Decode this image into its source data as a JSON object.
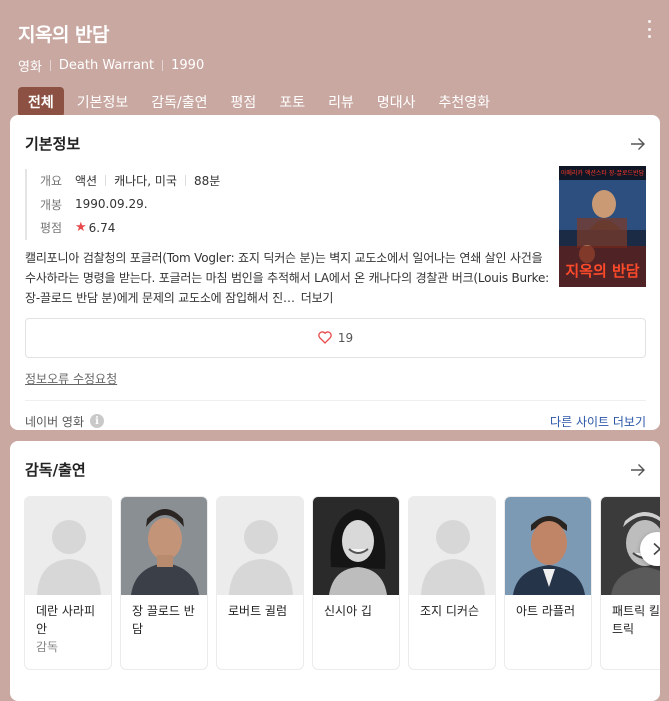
{
  "header": {
    "title": "지옥의 반담",
    "category": "영화",
    "original_title": "Death Warrant",
    "year": "1990",
    "tabs": [
      {
        "label": "전체",
        "active": true
      },
      {
        "label": "기본정보"
      },
      {
        "label": "감독/출연"
      },
      {
        "label": "평점"
      },
      {
        "label": "포토"
      },
      {
        "label": "리뷰"
      },
      {
        "label": "명대사"
      },
      {
        "label": "추천영화"
      }
    ]
  },
  "basic_info": {
    "title": "기본정보",
    "overview_label": "개요",
    "genre": "액션",
    "country": "캐나다, 미국",
    "runtime": "88분",
    "release_label": "개봉",
    "release_date": "1990.09.29.",
    "rating_label": "평점",
    "rating": "6.74",
    "poster": {
      "headline": "아메리카 액션스타 장-끌로드반담",
      "caption": "지옥의 반담"
    },
    "description": "캘리포니아 검찰청의 포글러(Tom Vogler: 죠지 딕커슨 분)는 벽지 교도소에서 일어나는 연쇄 살인 사건을 수사하라는 명령을 받는다. 포글러는 마침 범인을 추적해서 LA에서 온 캐나다의 경찰관 버크(Louis Burke: 장-끌로드 반담 분)에게 문제의 교도소에 잠입해서 진…",
    "more_label": "더보기",
    "like_count": "19",
    "report_label": "정보오류 수정요청",
    "source_label": "네이버 영화",
    "other_sites_label": "다른 사이트 더보기"
  },
  "cast_section": {
    "title": "감독/출연",
    "people": [
      {
        "name": "데란 사라피안",
        "role": "감독",
        "photo": "placeholder"
      },
      {
        "name": "장 끌로드 반담",
        "role": "",
        "photo": "man-short-hair"
      },
      {
        "name": "로버트 귈럼",
        "role": "",
        "photo": "placeholder"
      },
      {
        "name": "신시아 깁",
        "role": "",
        "photo": "woman-smiling"
      },
      {
        "name": "조지 디커슨",
        "role": "",
        "photo": "placeholder"
      },
      {
        "name": "아트 라플러",
        "role": "",
        "photo": "man-suit"
      },
      {
        "name": "패트릭 킬패트릭",
        "role": "",
        "photo": "man-grinning"
      }
    ]
  },
  "colors": {
    "header_bg": "#c9a8a2",
    "active_tab": "#8c5142",
    "star": "#e74a4a",
    "link": "#2a55a8"
  }
}
